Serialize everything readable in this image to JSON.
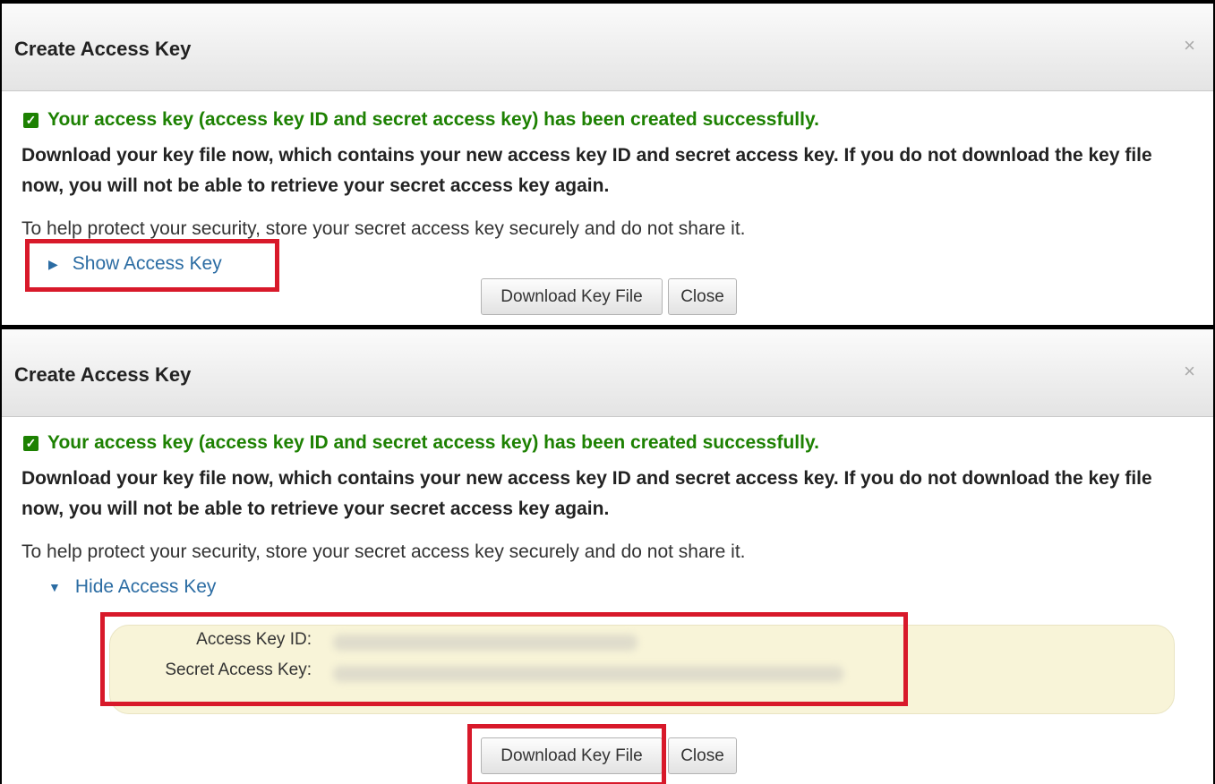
{
  "dialog_collapsed": {
    "title": "Create Access Key",
    "close_icon": "×",
    "success_message": "Your access key (access key ID and secret access key) has been created successfully.",
    "warning": "Download your key file now, which contains your new access key ID and secret access key. If you do not download the key file now, you will not be able to retrieve your secret access key again.",
    "protect_note": "To help protect your security, store your secret access key securely and do not share it.",
    "toggle_label": "Show Access Key",
    "toggle_icon": "▶",
    "download_button": "Download Key File",
    "close_button": "Close"
  },
  "dialog_expanded": {
    "title": "Create Access Key",
    "close_icon": "×",
    "success_message": "Your access key (access key ID and secret access key) has been created successfully.",
    "warning": "Download your key file now, which contains your new access key ID and secret access key. If you do not download the key file now, you will not be able to retrieve your secret access key again.",
    "protect_note": "To help protect your security, store your secret access key securely and do not share it.",
    "toggle_label": "Hide Access Key",
    "toggle_icon": "▼",
    "access_key_id_label": "Access Key ID:",
    "secret_access_key_label": "Secret Access Key:",
    "download_button": "Download Key File",
    "close_button": "Close"
  },
  "colors": {
    "success_green": "#1d8102",
    "link_blue": "#2b6ca3",
    "highlight_red": "#d8192a",
    "key_box_bg": "#f8f4d8"
  }
}
